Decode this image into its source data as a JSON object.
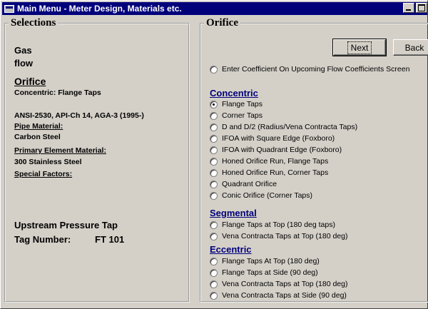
{
  "window": {
    "title": "Main Menu - Meter Design, Materials etc."
  },
  "selections": {
    "legend": "Selections",
    "fluid_line1": "Gas",
    "fluid_line2": "flow",
    "orifice_heading": "Orifice",
    "orifice_type": "Concentric: Flange Taps",
    "standards": "ANSI-2530, API-Ch 14, AGA-3 (1995-)",
    "pipe_material_label": "Pipe Material:",
    "pipe_material_value": "Carbon Steel",
    "primary_element_label": "Primary Element Material:",
    "primary_element_value": "300 Stainless Steel",
    "special_factors_label": "Special Factors:",
    "upstream_tap": "Upstream Pressure Tap",
    "tag_number_label": "Tag Number:",
    "tag_number_value": "FT 101"
  },
  "orifice": {
    "legend": "Orifice",
    "next_label": "Next",
    "back_label": "Back",
    "enter_coefficient": "Enter Coefficient On Upcoming Flow Coefficients Screen",
    "concentric_heading": "Concentric",
    "concentric_options": [
      "Flange Taps",
      "Corner Taps",
      "D  and  D/2 (Radius/Vena Contracta Taps)",
      "IFOA with Square Edge (Foxboro)",
      "IFOA with Quadrant Edge (Foxboro)",
      "Honed Orifice Run, Flange Taps",
      "Honed Orifice Run, Corner Taps",
      "Quadrant Orifice",
      "Conic Orifice (Corner Taps)"
    ],
    "segmental_heading": "Segmental",
    "segmental_options": [
      "Flange Taps at Top (180 deg taps)",
      "Vena Contracta Taps at Top (180 deg)"
    ],
    "eccentric_heading": "Eccentric",
    "eccentric_options": [
      "Flange Taps At Top (180 deg)",
      "Flange Taps at Side (90 deg)",
      "Vena Contracta Taps at Top (180 deg)",
      "Vena Contracta Taps at Side (90 deg)"
    ],
    "selected_option": "Flange Taps"
  },
  "colors": {
    "titlebar": "#00007b",
    "category_heading": "#00007b",
    "window_face": "#d4d0c8"
  }
}
